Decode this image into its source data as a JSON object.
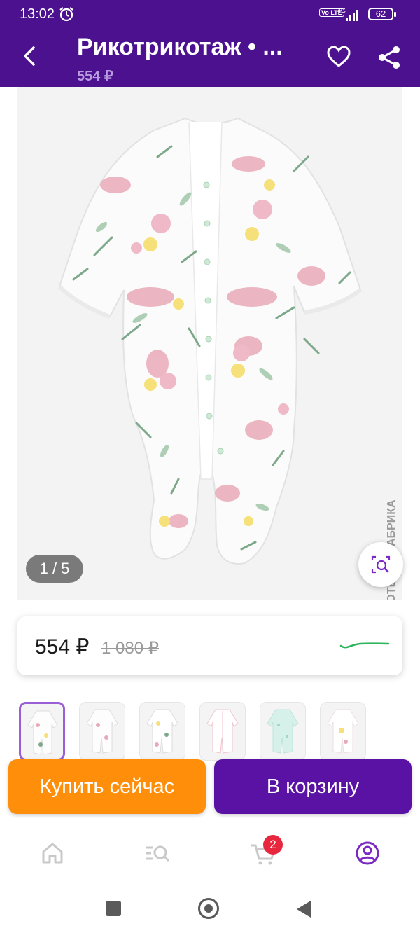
{
  "status_bar": {
    "time": "13:02",
    "network": "4G",
    "volte": "Vo LTE",
    "battery": "62"
  },
  "app_bar": {
    "title": "Рикотрикотаж • ...",
    "price": "554 ₽"
  },
  "gallery": {
    "counter": "1 / 5",
    "watermark": "РИКОТЕКС / ФАБРИКА"
  },
  "price_card": {
    "price": "554 ₽",
    "old_price": "1 080 ₽"
  },
  "thumbnails": {
    "count": 6,
    "active_index": 0
  },
  "actions": {
    "buy_now": "Купить сейчас",
    "add_to_cart": "В корзину"
  },
  "bottom_nav": {
    "items": [
      "home-icon",
      "catalog-search-icon",
      "cart-icon",
      "profile-icon"
    ],
    "cart_badge": "2",
    "active_color": "#7b2bc4",
    "inactive_color": "#c9c9c9"
  },
  "colors": {
    "brand": "#4c118f",
    "buy": "#ff8f0b",
    "cart": "#5a12a5"
  }
}
